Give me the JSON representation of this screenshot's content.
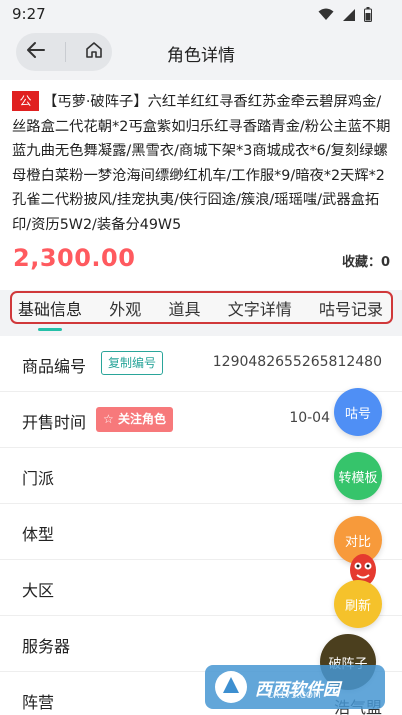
{
  "status_bar": {
    "time": "9:27"
  },
  "header": {
    "title": "角色详情"
  },
  "listing": {
    "tag": "公",
    "description": "【丐萝·破阵子】六红羊红红寻香红苏金牵云碧屏鸡金/丝路盒二代花朝*2丐盒紫如归乐红寻香踏青金/粉公主蓝不期蓝九曲无色舞凝露/黑雪衣/商城下架*3商城成衣*6/复刻绿螺母橙白菜粉一梦沧海间缥缈红机车/工作服*9/暗夜*2天辉*2孔雀二代粉披风/挂宠执夷/侠行囧途/簇浪/瑶瑶嗤/武器盒拓印/资历5W2/装备分49W5",
    "price": "2,300.00",
    "favorites_label": "收藏：",
    "favorites_count": "0"
  },
  "tabs": [
    "基础信息",
    "外观",
    "道具",
    "文字详情",
    "咕号记录"
  ],
  "active_tab": 0,
  "info_rows": [
    {
      "label": "商品编号",
      "button": "复制编号",
      "value": "1290482655265812480"
    },
    {
      "label": "开售时间",
      "button": "关注角色",
      "value": "10-04"
    },
    {
      "label": "门派",
      "value": ""
    },
    {
      "label": "体型",
      "value": ""
    },
    {
      "label": "大区",
      "value": ""
    },
    {
      "label": "服务器",
      "value": ""
    },
    {
      "label": "阵营",
      "value": ""
    }
  ],
  "floating_buttons": {
    "account": "咕号",
    "template": "转模板",
    "compare": "对比",
    "refresh": "刷新",
    "partial_text": "破阵子",
    "bottom_text": "浩气盟"
  },
  "watermark": {
    "text": "西西软件园",
    "sub": "CR173.COM"
  },
  "colors": {
    "accent": "#25c0a8",
    "price": "#ff5a5f",
    "tab_border": "#d0383a",
    "tag_red": "#e02020",
    "follow_button": "#f7797b",
    "fab_blue": "#4f8ff5",
    "fab_green": "#36c46b",
    "fab_orange": "#f79a3b",
    "fab_yellow": "#f5c22b"
  },
  "icons": {
    "back": "arrow-left-icon",
    "home": "home-icon",
    "wifi": "wifi-icon",
    "signal": "signal-icon",
    "battery": "battery-icon",
    "star": "star-icon"
  }
}
